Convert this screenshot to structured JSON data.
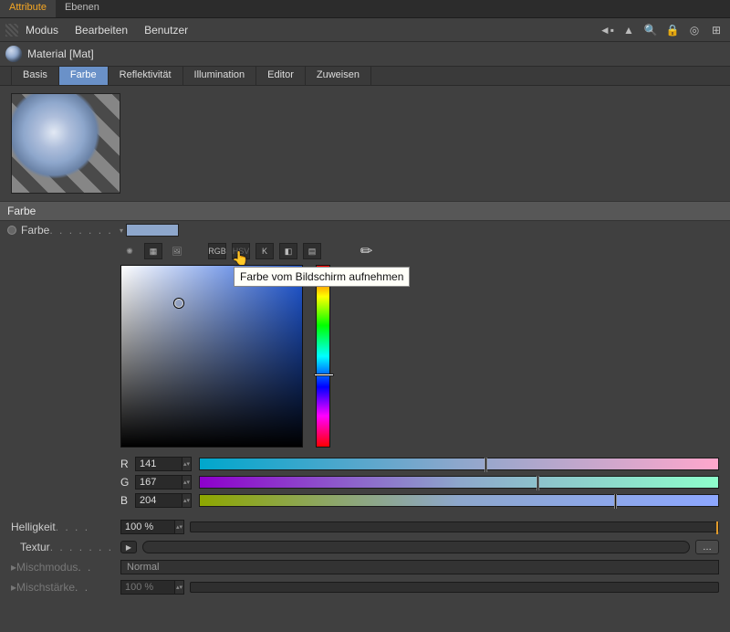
{
  "top_tabs": {
    "attribute": "Attribute",
    "ebenen": "Ebenen"
  },
  "menu": {
    "modus": "Modus",
    "bearbeiten": "Bearbeiten",
    "benutzer": "Benutzer"
  },
  "material": {
    "title": "Material [Mat]"
  },
  "channels": {
    "basis": "Basis",
    "farbe": "Farbe",
    "reflektivitaet": "Reflektivität",
    "illumination": "Illumination",
    "editor": "Editor",
    "zuweisen": "Zuweisen"
  },
  "section": {
    "farbe": "Farbe"
  },
  "labels": {
    "farbe": "Farbe",
    "helligkeit": "Helligkeit",
    "textur": "Textur",
    "mischmodus": "Mischmodus",
    "mischstaerke": "Mischstärke"
  },
  "icons": {
    "rgb": "RGB",
    "hsv": "HSV"
  },
  "tooltip": "Farbe vom Bildschirm aufnehmen",
  "rgb": {
    "r_label": "R",
    "g_label": "G",
    "b_label": "B",
    "r": "141",
    "g": "167",
    "b": "204"
  },
  "values": {
    "helligkeit": "100 %",
    "mischmodus": "Normal",
    "mischstaerke": "100 %"
  },
  "color": {
    "swatch": "#8ea7cc"
  }
}
